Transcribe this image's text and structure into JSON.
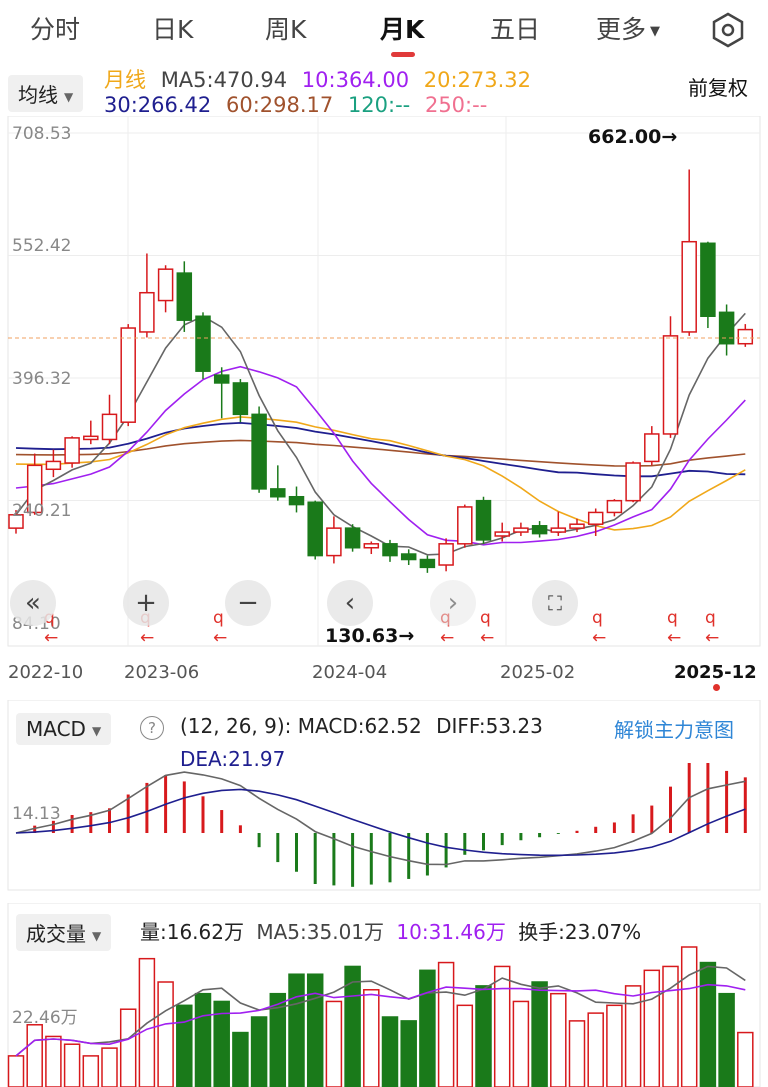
{
  "tabs": [
    {
      "label": "分时"
    },
    {
      "label": "日K"
    },
    {
      "label": "周K"
    },
    {
      "label": "月K"
    },
    {
      "label": "五日"
    },
    {
      "label": "更多"
    }
  ],
  "active_tab": "月K",
  "ma_selector": {
    "label": "均线"
  },
  "ma_legend": {
    "period": "月线",
    "ma5": "MA5:470.94",
    "ma10": "10:364.00",
    "ma20": "20:273.32",
    "ma30": "30:266.42",
    "ma60": "60:298.17",
    "ma120": "120:--",
    "ma250": "250:--"
  },
  "adjust_label": "前复权",
  "price_axis": {
    "top": "708.53",
    "l2": "552.42",
    "l3": "396.32",
    "l4": "240.21",
    "bottom": "84.10"
  },
  "highlights": {
    "high": "662.00→",
    "low": "130.63→"
  },
  "date_axis": [
    "2022-10",
    "2023-06",
    "2024-04",
    "2025-02",
    "2025-12"
  ],
  "markers": [
    "q",
    "q",
    "q",
    "q",
    "q",
    "q",
    "q",
    "q"
  ],
  "macd": {
    "selector": "MACD",
    "params": "(12, 26, 9):",
    "macd": "MACD:62.52",
    "diff": "DIFF:53.23",
    "dea": "DEA:21.97",
    "unlock": "解锁主力意图",
    "axis": "14.13"
  },
  "volume": {
    "selector": "成交量",
    "vol": "量:16.62万",
    "ma5": "MA5:35.01万",
    "ma10": "10:31.46万",
    "turnover": "换手:23.07%",
    "axis": "22.46万"
  },
  "colors": {
    "up": "#d7191c",
    "down": "#1a7a1a",
    "ma5": "#666666",
    "ma10": "#a020f0",
    "ma20": "#f0a81a",
    "ma30": "#1f1f8f",
    "ma60": "#a0522d",
    "ma120": "#1aa080",
    "ma250": "#f07090",
    "period_label": "#f0a81a",
    "link": "#2f86d6"
  },
  "candles": [
    {
      "o": 205,
      "c": 222,
      "h": 228,
      "l": 198
    },
    {
      "o": 225,
      "c": 285,
      "h": 300,
      "l": 222
    },
    {
      "o": 280,
      "c": 290,
      "h": 305,
      "l": 270
    },
    {
      "o": 288,
      "c": 320,
      "h": 322,
      "l": 282
    },
    {
      "o": 318,
      "c": 322,
      "h": 342,
      "l": 312
    },
    {
      "o": 318,
      "c": 350,
      "h": 375,
      "l": 312
    },
    {
      "o": 340,
      "c": 460,
      "h": 465,
      "l": 335
    },
    {
      "o": 455,
      "c": 505,
      "h": 555,
      "l": 448
    },
    {
      "o": 495,
      "c": 535,
      "h": 540,
      "l": 480
    },
    {
      "o": 530,
      "c": 470,
      "h": 545,
      "l": 455
    },
    {
      "o": 475,
      "c": 405,
      "h": 480,
      "l": 395
    },
    {
      "o": 400,
      "c": 390,
      "h": 410,
      "l": 345
    },
    {
      "o": 390,
      "c": 350,
      "h": 395,
      "l": 340
    },
    {
      "o": 350,
      "c": 255,
      "h": 360,
      "l": 250
    },
    {
      "o": 255,
      "c": 245,
      "h": 285,
      "l": 240
    },
    {
      "o": 245,
      "c": 235,
      "h": 258,
      "l": 225
    },
    {
      "o": 238,
      "c": 170,
      "h": 240,
      "l": 165
    },
    {
      "o": 170,
      "c": 205,
      "h": 220,
      "l": 160
    },
    {
      "o": 205,
      "c": 180,
      "h": 210,
      "l": 175
    },
    {
      "o": 180,
      "c": 185,
      "h": 188,
      "l": 172
    },
    {
      "o": 185,
      "c": 170,
      "h": 190,
      "l": 162
    },
    {
      "o": 172,
      "c": 165,
      "h": 178,
      "l": 158
    },
    {
      "o": 165,
      "c": 155,
      "h": 170,
      "l": 148
    },
    {
      "o": 158,
      "c": 185,
      "h": 192,
      "l": 150
    },
    {
      "o": 185,
      "c": 232,
      "h": 235,
      "l": 180
    },
    {
      "o": 240,
      "c": 190,
      "h": 245,
      "l": 185
    },
    {
      "o": 195,
      "c": 200,
      "h": 212,
      "l": 188
    },
    {
      "o": 200,
      "c": 205,
      "h": 212,
      "l": 195
    },
    {
      "o": 208,
      "c": 198,
      "h": 214,
      "l": 193
    },
    {
      "o": 200,
      "c": 205,
      "h": 226,
      "l": 195
    },
    {
      "o": 205,
      "c": 210,
      "h": 217,
      "l": 200
    },
    {
      "o": 210,
      "c": 225,
      "h": 230,
      "l": 195
    },
    {
      "o": 225,
      "c": 240,
      "h": 242,
      "l": 220
    },
    {
      "o": 240,
      "c": 288,
      "h": 290,
      "l": 238
    },
    {
      "o": 290,
      "c": 325,
      "h": 335,
      "l": 285
    },
    {
      "o": 325,
      "c": 450,
      "h": 475,
      "l": 320
    },
    {
      "o": 455,
      "c": 570,
      "h": 662,
      "l": 450
    },
    {
      "o": 568,
      "c": 475,
      "h": 570,
      "l": 460
    },
    {
      "o": 480,
      "c": 440,
      "h": 490,
      "l": 425
    },
    {
      "o": 440,
      "c": 458,
      "h": 465,
      "l": 436
    }
  ],
  "volumes": [
    8,
    16,
    13,
    11,
    8,
    10,
    20,
    33,
    27,
    21,
    24,
    22,
    14,
    18,
    24,
    29,
    29,
    22,
    31,
    25,
    18,
    17,
    30,
    32,
    21,
    26,
    31,
    22,
    27,
    24,
    17,
    19,
    21,
    26,
    30,
    31,
    36,
    32,
    24,
    14
  ]
}
